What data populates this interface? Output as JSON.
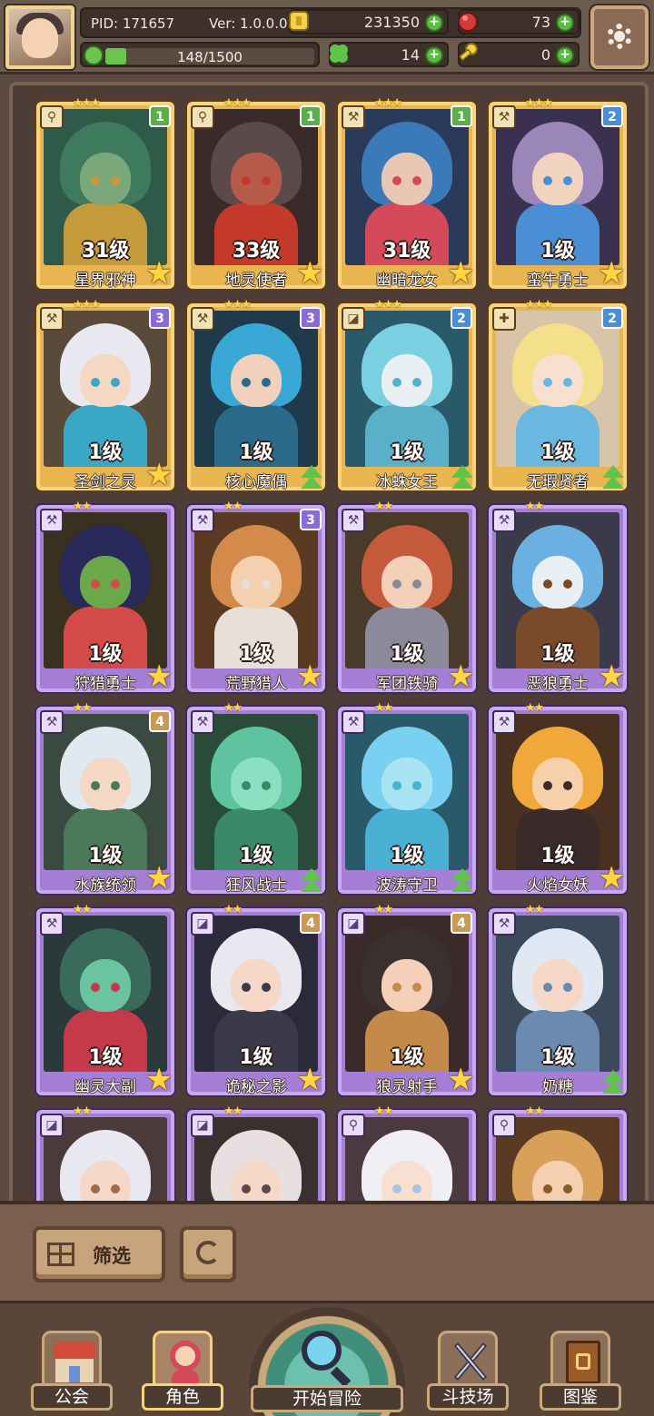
{
  "hud": {
    "pid": "PID: 171657",
    "version": "Ver: 1.0.0.0",
    "gold": "231350",
    "gems": "73",
    "clover": "14",
    "keys": "0",
    "xp_text": "148/1500",
    "xp_progress": 0.0987
  },
  "heroes": [
    {
      "name": "星界邪神",
      "level": "31级",
      "stars": "★★★",
      "frame": "gold",
      "tier": "1",
      "badge": "star",
      "weapon": "staff",
      "palette": [
        "#2f5a4a",
        "#3e7a5e",
        "#7aa87a",
        "#c49a3a"
      ]
    },
    {
      "name": "地灵使者",
      "level": "33级",
      "stars": "★★★",
      "frame": "gold",
      "tier": "1",
      "badge": "star",
      "weapon": "staff",
      "palette": [
        "#3b2a2a",
        "#5a4a4a",
        "#b85a4a",
        "#c43a2a"
      ]
    },
    {
      "name": "幽暗龙女",
      "level": "31级",
      "stars": "★★★",
      "frame": "gold",
      "tier": "1",
      "badge": "star",
      "weapon": "axe",
      "palette": [
        "#2a3a5a",
        "#3a7ab8",
        "#e8c8b4",
        "#d44a5a"
      ]
    },
    {
      "name": "蛮牛勇士",
      "level": "1级",
      "stars": "★★★",
      "frame": "gold",
      "tier": "2",
      "badge": "star",
      "weapon": "axe",
      "palette": [
        "#3a3050",
        "#9a86b8",
        "#f1d4c0",
        "#4a8fd4"
      ]
    },
    {
      "name": "圣剑之灵",
      "level": "1级",
      "stars": "★★★",
      "frame": "gold",
      "tier": "3",
      "badge": "star",
      "weapon": "axe",
      "palette": [
        "#5a4a3a",
        "#e8e8f0",
        "#f5d8c4",
        "#3aa8c4"
      ]
    },
    {
      "name": "核心魔偶",
      "level": "1级",
      "stars": "★★★",
      "frame": "gold",
      "tier": "3",
      "badge": "up",
      "weapon": "axe",
      "palette": [
        "#1f3a4a",
        "#3aa8d4",
        "#f1d0bc",
        "#2a6a8a"
      ]
    },
    {
      "name": "冰蛛女王",
      "level": "1级",
      "stars": "★★★",
      "frame": "gold",
      "tier": "2",
      "badge": "up",
      "weapon": "bow",
      "palette": [
        "#2a5a6a",
        "#7ad0e0",
        "#e8f0f4",
        "#5ab0c8"
      ]
    },
    {
      "name": "无瑕贤者",
      "level": "1级",
      "stars": "★★★",
      "frame": "gold",
      "tier": "2",
      "badge": "up",
      "weapon": "cross",
      "palette": [
        "#d8c4a8",
        "#f4e08a",
        "#f8e0d0",
        "#6ab8e0"
      ]
    },
    {
      "name": "狩猎勇士",
      "level": "1级",
      "stars": "★★",
      "frame": "purple",
      "tier": "",
      "badge": "star",
      "weapon": "axe",
      "palette": [
        "#3a3020",
        "#2a2a5a",
        "#6aa84a",
        "#d44a4a"
      ]
    },
    {
      "name": "荒野猎人",
      "level": "1级",
      "stars": "★★",
      "frame": "purple",
      "tier": "3",
      "badge": "star",
      "weapon": "axe",
      "palette": [
        "#5a3a22",
        "#d48a4a",
        "#f5d0b0",
        "#e8e0d8"
      ]
    },
    {
      "name": "军团铁骑",
      "level": "1级",
      "stars": "★★",
      "frame": "purple",
      "tier": "",
      "badge": "star",
      "weapon": "axe",
      "palette": [
        "#4a3a2a",
        "#c45a3a",
        "#f5d0b8",
        "#8a8a9a"
      ]
    },
    {
      "name": "恶狼勇士",
      "level": "1级",
      "stars": "★★",
      "frame": "purple",
      "tier": "",
      "badge": "star",
      "weapon": "axe",
      "palette": [
        "#3a3a4a",
        "#6ab0e0",
        "#e8f0f4",
        "#7a4a2a"
      ]
    },
    {
      "name": "水族统领",
      "level": "1级",
      "stars": "★★",
      "frame": "purple",
      "tier": "4",
      "badge": "star",
      "weapon": "axe",
      "palette": [
        "#3a4a40",
        "#e0e8f0",
        "#f5d8c4",
        "#4a7a5a"
      ]
    },
    {
      "name": "狂风战士",
      "level": "1级",
      "stars": "★★",
      "frame": "purple",
      "tier": "",
      "badge": "up",
      "weapon": "axe",
      "palette": [
        "#2a4a3a",
        "#5ec4a0",
        "#8ae0c0",
        "#3a8a6a"
      ]
    },
    {
      "name": "波涛守卫",
      "level": "1级",
      "stars": "★★",
      "frame": "purple",
      "tier": "",
      "badge": "up",
      "weapon": "axe",
      "palette": [
        "#2a5a6a",
        "#7ad0f0",
        "#a8e4f4",
        "#4ab0d4"
      ]
    },
    {
      "name": "火焰女妖",
      "level": "1级",
      "stars": "★★",
      "frame": "purple",
      "tier": "",
      "badge": "star",
      "weapon": "axe",
      "palette": [
        "#4a3020",
        "#f0a83a",
        "#f5d0a8",
        "#3a2a2a"
      ]
    },
    {
      "name": "幽灵大副",
      "level": "1级",
      "stars": "★★",
      "frame": "purple",
      "tier": "",
      "badge": "star",
      "weapon": "axe",
      "palette": [
        "#2a3a3a",
        "#3a6a5a",
        "#6ac4a0",
        "#c43a4a"
      ]
    },
    {
      "name": "诡秘之影",
      "level": "1级",
      "stars": "★★",
      "frame": "purple",
      "tier": "4",
      "badge": "star",
      "weapon": "bow",
      "palette": [
        "#2a2a3a",
        "#e8e8f0",
        "#f5d8c8",
        "#3a3a4a"
      ]
    },
    {
      "name": "狼灵射手",
      "level": "1级",
      "stars": "★★",
      "frame": "purple",
      "tier": "4",
      "badge": "star",
      "weapon": "bow",
      "palette": [
        "#3a2a2a",
        "#3a3030",
        "#f5d0b8",
        "#c48a4a"
      ]
    },
    {
      "name": "奶糖",
      "level": "1级",
      "stars": "★★",
      "frame": "purple",
      "tier": "",
      "badge": "up",
      "weapon": "axe",
      "palette": [
        "#3a4a5a",
        "#e0e8f4",
        "#f5d8c8",
        "#6a8ab0"
      ]
    },
    {
      "name": "",
      "level": "",
      "stars": "★★",
      "frame": "purple",
      "tier": "",
      "badge": "",
      "weapon": "bow",
      "palette": [
        "#4a3a3a",
        "#e8e8f0",
        "#f5d8c8",
        "#a06a4a"
      ]
    },
    {
      "name": "",
      "level": "",
      "stars": "★★",
      "frame": "purple",
      "tier": "",
      "badge": "",
      "weapon": "bow",
      "palette": [
        "#3a3030",
        "#e8e0e0",
        "#f5d8c8",
        "#5a4a4a"
      ]
    },
    {
      "name": "",
      "level": "",
      "stars": "★★",
      "frame": "purple",
      "tier": "",
      "badge": "",
      "weapon": "staff",
      "palette": [
        "#4a3a40",
        "#f0f0f4",
        "#f8e0d0",
        "#a8c4e0"
      ]
    },
    {
      "name": "",
      "level": "",
      "stars": "★★",
      "frame": "purple",
      "tier": "",
      "badge": "",
      "weapon": "staff",
      "palette": [
        "#5a3a22",
        "#d8a058",
        "#f5d0b0",
        "#8a5a2a"
      ]
    }
  ],
  "toolbar": {
    "filter_label": "筛选"
  },
  "nav": {
    "guild": "公会",
    "character": "角色",
    "adventure": "开始冒险",
    "arena": "斗技场",
    "codex": "图鉴"
  },
  "colors": {
    "accent_green": "#5cb945",
    "gold_frame": "#e9b54f",
    "purple_frame": "#a57fd6",
    "background": "#5a4a40"
  }
}
